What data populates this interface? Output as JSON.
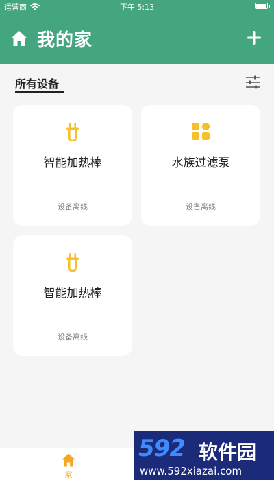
{
  "status_bar": {
    "carrier": "运营商",
    "time": "下午 5:13",
    "icons": [
      "wifi-icon",
      "battery-icon"
    ]
  },
  "header": {
    "title": "我的家",
    "home_icon": "home-icon",
    "add_icon": "plus-icon",
    "background_color": "#44a67f"
  },
  "section": {
    "tab_label": "所有设备",
    "filter_icon": "sliders-icon"
  },
  "devices": [
    {
      "name": "智能加热棒",
      "status": "设备离线",
      "icon": "heater-rod-icon"
    },
    {
      "name": "水族过滤泵",
      "status": "设备离线",
      "icon": "filter-pump-icon"
    },
    {
      "name": "智能加热棒",
      "status": "设备离线",
      "icon": "heater-rod-icon"
    }
  ],
  "bottom_nav": {
    "items": [
      {
        "label": "家",
        "icon": "home-icon",
        "active": true
      }
    ],
    "active_color": "#f5a623"
  },
  "watermark": {
    "logo": "592",
    "brand": "软件园",
    "url": "www.592xiazai.com"
  },
  "colors": {
    "accent": "#f5a623",
    "header": "#44a67f",
    "page_background": "#f5f5f5"
  }
}
